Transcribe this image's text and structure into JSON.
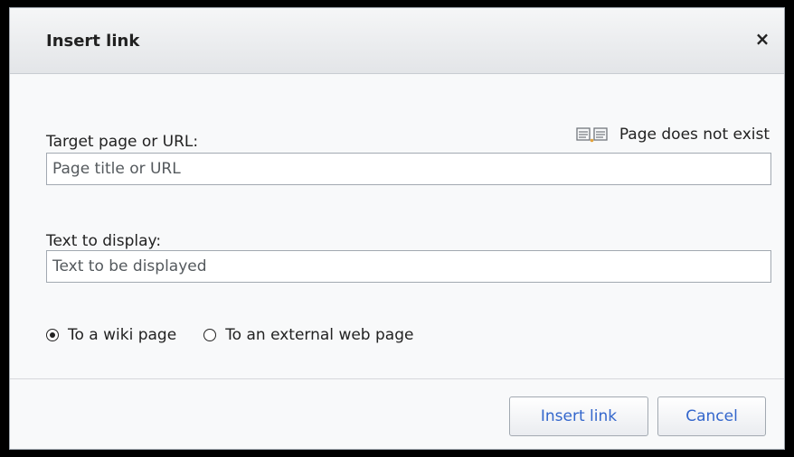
{
  "dialog": {
    "title": "Insert link",
    "close_label": "×"
  },
  "target": {
    "label": "Target page or URL:",
    "placeholder": "Page title or URL",
    "status_text": "Page does not exist",
    "status_icon": "page-not-found-icon"
  },
  "display": {
    "label": "Text to display:",
    "placeholder": "Text to be displayed"
  },
  "link_type": {
    "options": [
      {
        "label": "To a wiki page",
        "checked": true
      },
      {
        "label": "To an external web page",
        "checked": false
      }
    ]
  },
  "buttons": {
    "insert_label": "Insert link",
    "cancel_label": "Cancel"
  },
  "colors": {
    "accent_link": "#3366cc",
    "text": "#222222",
    "border": "#a2a9b1"
  }
}
